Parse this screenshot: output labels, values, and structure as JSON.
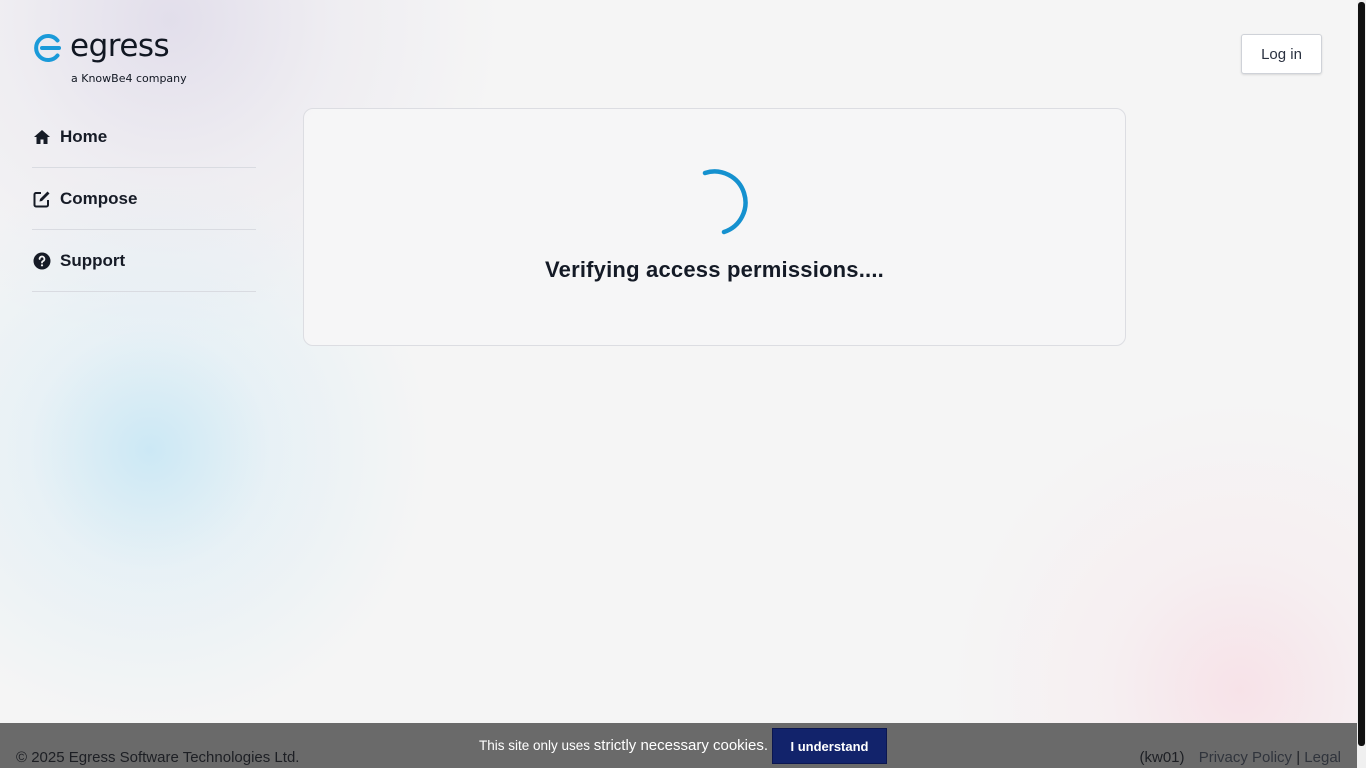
{
  "brand": {
    "name": "egress",
    "tagline": "a KnowBe4 company",
    "accent_color": "#1a9ad9"
  },
  "header": {
    "login_label": "Log in"
  },
  "sidebar": {
    "items": [
      {
        "label": "Home",
        "icon": "home-icon"
      },
      {
        "label": "Compose",
        "icon": "compose-icon"
      },
      {
        "label": "Support",
        "icon": "help-icon"
      }
    ]
  },
  "main": {
    "status_message": "Verifying access permissions....",
    "spinner_color": "#1591cf"
  },
  "footer": {
    "copyright": "© 2025 Egress Software Technologies Ltd.",
    "cookie_prefix": "This site only uses ",
    "cookie_emphasis": "strictly necessary cookies.",
    "cookie_button": "I understand",
    "build_code": "(kw01)",
    "privacy_link": "Privacy Policy",
    "separator": "|",
    "legal_link": "Legal"
  }
}
